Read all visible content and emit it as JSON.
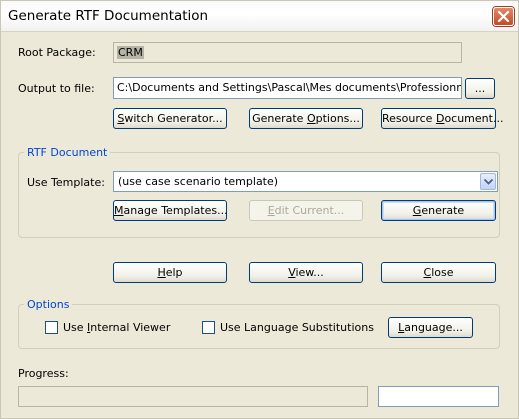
{
  "window": {
    "title": "Generate RTF Documentation"
  },
  "root_package": {
    "label": "Root Package:",
    "value": "CRM"
  },
  "output": {
    "label": "Output to file:",
    "value": "C:\\Documents and Settings\\Pascal\\Mes documents\\Professionnel\\Doc",
    "browse_label": "..."
  },
  "top_buttons": {
    "switch_generator": {
      "pre": "",
      "key": "S",
      "post": "witch Generator..."
    },
    "generate_options": {
      "pre": "Generate ",
      "key": "O",
      "post": "ptions..."
    },
    "resource_document": {
      "pre": "Resource ",
      "key": "D",
      "post": "ocument..."
    }
  },
  "rtf_group": {
    "title": "RTF Document",
    "template_label": "Use Template:",
    "template_value": "(use case scenario template)",
    "manage": {
      "pre": "",
      "key": "M",
      "post": "anage Templates..."
    },
    "edit": {
      "pre": "",
      "key": "E",
      "post": "dit Current..."
    },
    "generate": {
      "pre": "",
      "key": "G",
      "post": "enerate"
    }
  },
  "mid_buttons": {
    "help": {
      "pre": "",
      "key": "H",
      "post": "elp"
    },
    "view": {
      "pre": "",
      "key": "V",
      "post": "iew..."
    },
    "close": {
      "pre": "",
      "key": "C",
      "post": "lose"
    }
  },
  "options": {
    "title": "Options",
    "internal_viewer": {
      "pre": "Use ",
      "key": "I",
      "post": "nternal Viewer",
      "checked": false
    },
    "lang_subst": {
      "pre": "Use Language Substitutions",
      "key": "",
      "post": "",
      "checked": false
    },
    "language": {
      "pre": "",
      "key": "L",
      "post": "anguage..."
    }
  },
  "progress": {
    "label": "Progress:",
    "fraction": 0,
    "status_text": ""
  },
  "colors": {
    "accent": "#0046d5",
    "button_border": "#003c74"
  }
}
